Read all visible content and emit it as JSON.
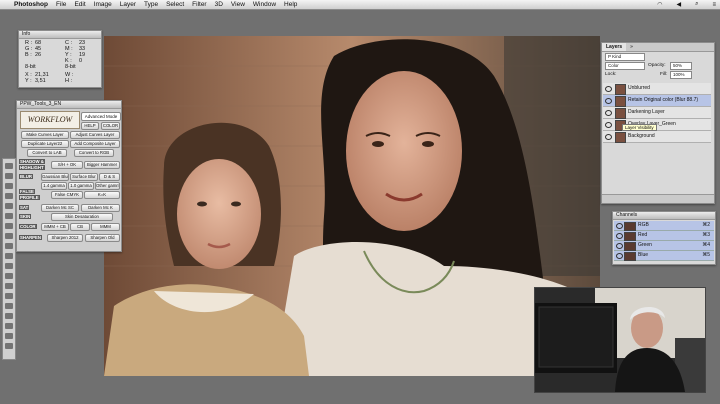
{
  "menubar": {
    "app": "Photoshop",
    "items": [
      "File",
      "Edit",
      "Image",
      "Layer",
      "Type",
      "Select",
      "Filter",
      "3D",
      "View",
      "Window",
      "Help"
    ]
  },
  "info": {
    "title": "Info",
    "rgb": [
      "R :",
      "G :",
      "B :"
    ],
    "rgb_vals": [
      "68",
      "45",
      "26"
    ],
    "cmyk": [
      "C :",
      "M :",
      "Y :",
      "K :"
    ],
    "cmyk_vals": [
      "23",
      "33",
      "19",
      "0"
    ],
    "bit_left": "8-bit",
    "bit_right": "8-bit",
    "xy_left": [
      "X :",
      "Y :"
    ],
    "xy_vals": [
      "21,31",
      "3,51"
    ],
    "wh_left": [
      "W :",
      "H :"
    ]
  },
  "ppw": {
    "title": "PPW_Tools_3_EN",
    "logo": "WORKFLOW",
    "mode": "Advanced Mode",
    "help": "HELP",
    "color": "COLOR",
    "make_curves": "Make Curves Layer",
    "adjust_curves": "Adjust Curves Layer",
    "duplicate": "Duplicate Layer22",
    "add_composite": "Add Composite Layer",
    "convert_lab": "Convert to LAB",
    "convert_rgb": "Convert to RGB",
    "shadow_label": "SHADOW &",
    "highlight_label": "HIGHLIGHT",
    "shadow_btns": [
      "S/H + OK",
      "Bigger Hammer"
    ],
    "blur_label": "BLUR",
    "blur_btns": [
      "Gaussian Blur",
      "Surface Blur",
      "D & S"
    ],
    "gamma_btns": [
      "1.4 gamma",
      "1.0 gamma",
      "Other gamma"
    ],
    "false_label": "FALSE",
    "profile_label": "PROFILE",
    "profile_btns": [
      "False CMYK",
      "K=K"
    ],
    "sat_label": "SAT",
    "sat_btns": [
      "Darken Mc SC",
      "Darken Mc K"
    ],
    "skin_label": "SKIN",
    "skin_btn": "Skin Desaturation",
    "color_label": "COLOR",
    "color_btns": [
      "MMM + CB",
      "CB",
      "MMM"
    ],
    "sharpen_label": "SHARPEN",
    "sharpen_btns": [
      "Sharpen 2012",
      "Sharpen Old"
    ]
  },
  "layers": {
    "tab_layers": "Layers",
    "tab_other": "»",
    "kind": "P Kind",
    "blend": "Color",
    "opacity_label": "Opacity:",
    "opacity": "50%",
    "lock_label": "Lock:",
    "fill_label": "Fill:",
    "fill": "100%",
    "items": [
      "Unblurred",
      "Retain Original color (Blur 88.7)",
      "Darkening Layer",
      "Overlay Layer_Green",
      "Background"
    ],
    "tooltip": "Layer Visibility"
  },
  "channels": {
    "title": "Channels",
    "items": [
      {
        "name": "RGB",
        "shortcut": "⌘2"
      },
      {
        "name": "Red",
        "shortcut": "⌘3"
      },
      {
        "name": "Green",
        "shortcut": "⌘4"
      },
      {
        "name": "Blue",
        "shortcut": "⌘5"
      }
    ]
  },
  "colors": {
    "selection": "#b7c4e6",
    "panel": "#d9d9d9",
    "workspace": "#707070"
  }
}
